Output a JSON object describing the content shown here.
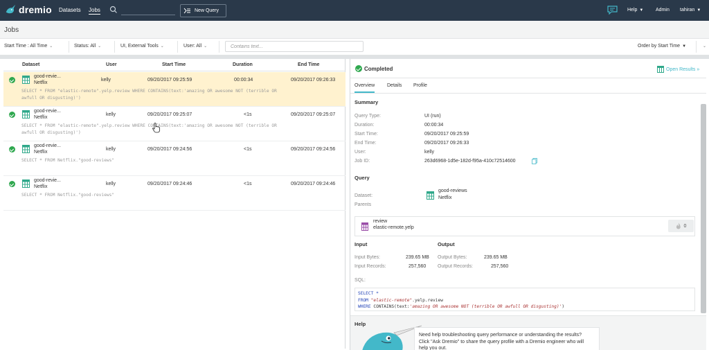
{
  "nav": {
    "logo_text": "dremio",
    "datasets": "Datasets",
    "jobs": "Jobs",
    "new_query": "New Query",
    "help": "Help",
    "admin": "Admin",
    "user": "tahiran"
  },
  "page_title": "Jobs",
  "filters": {
    "start_time": "Start Time : All Time",
    "status": "Status: All",
    "tools": "UI, External Tools",
    "user": "User: All",
    "contains_placeholder": "Contains text...",
    "order_by": "Order by Start Time"
  },
  "table": {
    "headers": [
      "Dataset",
      "User",
      "Start Time",
      "Duration",
      "End Time"
    ],
    "rows": [
      {
        "dataset": "good-revie...",
        "space": "Netflix",
        "user": "kelly",
        "start": "09/20/2017 09:25:59",
        "duration": "00:00:34",
        "end": "09/20/2017 09:26:33",
        "sql1": "SELECT * FROM \"elastic-remote\".yelp.review WHERE CONTAINS(text:'amazing OR awesome NOT (terrible OR",
        "sql2": "awfull OR disgusting)')",
        "status": "completed"
      },
      {
        "dataset": "good-revie...",
        "space": "Netflix",
        "user": "kelly",
        "start": "09/20/2017 09:25:07",
        "duration": "<1s",
        "end": "09/20/2017 09:25:07",
        "sql1": "SELECT * FROM \"elastic-remote\".yelp.review WHERE CONTAINS(text:'amazing OR awesome NOT (terrible OR",
        "sql2": "awfull OR disgusting)')",
        "status": "completed"
      },
      {
        "dataset": "good-revie...",
        "space": "Netflix",
        "user": "kelly",
        "start": "09/20/2017 09:24:56",
        "duration": "<1s",
        "end": "09/20/2017 09:24:56",
        "sql1": "SELECT * FROM Netflix.\"good-reviews\"",
        "sql2": "",
        "status": "completed"
      },
      {
        "dataset": "good-revie...",
        "space": "Netflix",
        "user": "kelly",
        "start": "09/20/2017 09:24:46",
        "duration": "<1s",
        "end": "09/20/2017 09:24:46",
        "sql1": "SELECT * FROM Netflix.\"good-reviews\"",
        "sql2": "",
        "status": "completed"
      }
    ]
  },
  "detail": {
    "status": "Completed",
    "open_results": "Open Results »",
    "tabs": [
      "Overview",
      "Details",
      "Profile"
    ],
    "summary_title": "Summary",
    "summary": [
      {
        "label": "Query Type:",
        "value": "UI (run)"
      },
      {
        "label": "Duration:",
        "value": "00:00:34"
      },
      {
        "label": "Start Time:",
        "value": "09/20/2017 09:25:59"
      },
      {
        "label": "End Time:",
        "value": "09/20/2017 09:26:33"
      },
      {
        "label": "User:",
        "value": "kelly"
      },
      {
        "label": "Job ID:",
        "value": "263d6968-1d5e-182d-f95a-410c72514600"
      }
    ],
    "query_title": "Query",
    "dataset_label": "Dataset:",
    "dataset_name": "good-reviews",
    "dataset_space": "Netflix",
    "parents_label": "Parents",
    "parent_name": "review",
    "parent_path": "elastic-remote.yelp",
    "parent_count": "0",
    "input_title": "Input",
    "output_title": "Output",
    "input_bytes_label": "Input Bytes:",
    "input_bytes": "239.65 MB",
    "input_records_label": "Input Records:",
    "input_records": "257,560",
    "output_bytes_label": "Output Bytes:",
    "output_bytes": "239.65 MB",
    "output_records_label": "Output Records:",
    "output_records": "257,560",
    "sql_label": "SQL:",
    "sql_select": "SELECT *",
    "sql_from_kw": "FROM",
    "sql_from_tbl": "\"elastic-remote\"",
    "sql_from_rest": ".yelp.review",
    "sql_where_kw": "WHERE",
    "sql_where_fn": " CONTAINS(text:",
    "sql_where_str": "'amazing OR awesome NOT (terrible OR awfull OR disgusting)'",
    "sql_where_end": ")",
    "help_title": "Help",
    "help_text": "Need help troubleshooting query performance or understanding the results? Click \"Ask Dremio\" to share the query profile with a Dremio engineer who will help you out."
  },
  "colors": {
    "nav_bg": "#2a394a",
    "accent": "#43b8c9",
    "success": "#2fa84f",
    "selected_row": "#fff2cf"
  }
}
